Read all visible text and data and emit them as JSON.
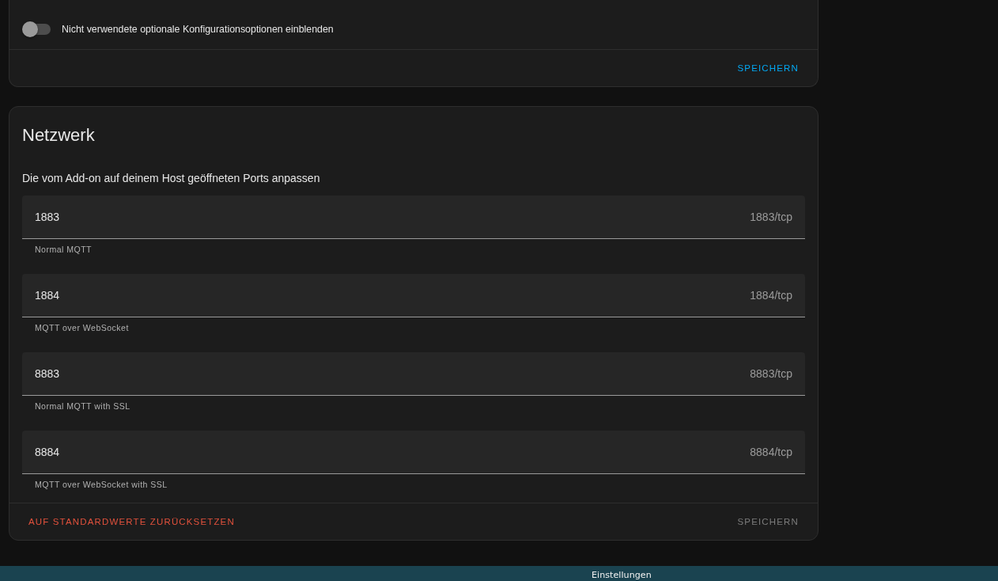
{
  "config_card": {
    "toggle": {
      "label": "Nicht verwendete optionale Konfigurationsoptionen einblenden",
      "on": false
    },
    "buttons": [
      {
        "label": "SPEICHERN",
        "kind": "primary",
        "disabled": false
      }
    ]
  },
  "network_card": {
    "title": "Netzwerk",
    "description": "Die vom Add-on auf deinem Host geöffneten Ports anpassen",
    "ports": [
      {
        "value": "1883",
        "suffix": "1883/tcp",
        "helper": "Normal MQTT"
      },
      {
        "value": "1884",
        "suffix": "1884/tcp",
        "helper": "MQTT over WebSocket"
      },
      {
        "value": "8883",
        "suffix": "8883/tcp",
        "helper": "Normal MQTT with SSL"
      },
      {
        "value": "8884",
        "suffix": "8884/tcp",
        "helper": "MQTT over WebSocket with SSL"
      }
    ],
    "buttons": [
      {
        "label": "AUF STANDARDWERTE ZURÜCKSETZEN",
        "kind": "danger",
        "disabled": false
      },
      {
        "label": "SPEICHERN",
        "kind": "primary",
        "disabled": true
      }
    ]
  },
  "desktop": {
    "labels": [
      "Einstellungen"
    ]
  }
}
